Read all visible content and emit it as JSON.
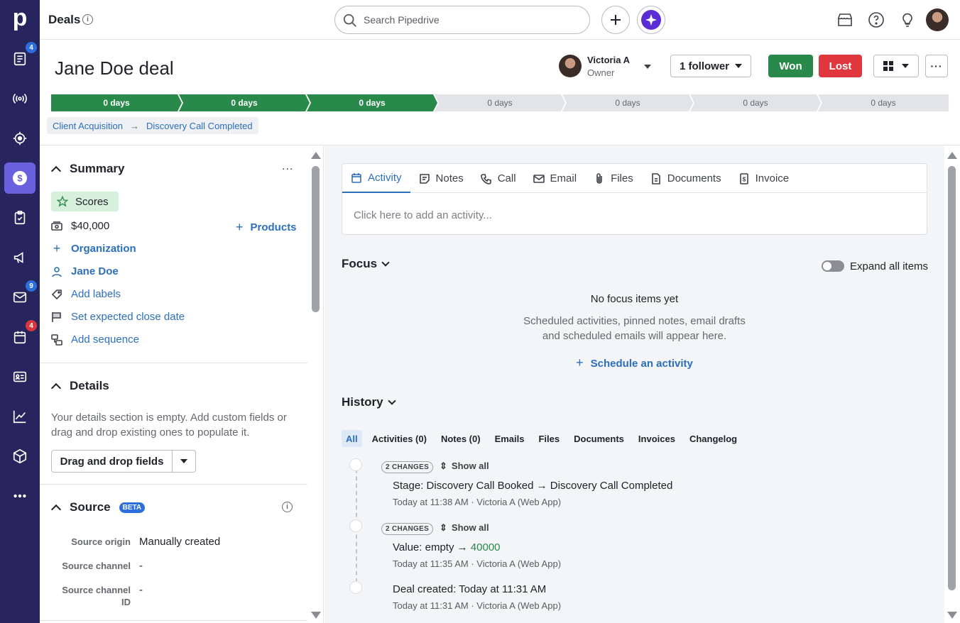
{
  "app": {
    "brand_letter": "p",
    "accent": "#6a61e0",
    "nav_bg": "#26255e"
  },
  "nav": {
    "items": [
      {
        "icon": "leads-icon",
        "badge": "4"
      },
      {
        "icon": "broadcast-icon"
      },
      {
        "icon": "target-icon"
      },
      {
        "icon": "deals-dollar-icon",
        "active": true
      },
      {
        "icon": "tasks-icon"
      },
      {
        "icon": "megaphone-icon"
      },
      {
        "icon": "mail-icon",
        "badge": "9"
      },
      {
        "icon": "calendar-icon",
        "badge": "4"
      },
      {
        "icon": "contacts-card-icon"
      },
      {
        "icon": "insights-chart-icon"
      },
      {
        "icon": "products-box-icon"
      },
      {
        "icon": "more-icon"
      }
    ]
  },
  "topbar": {
    "title": "Deals",
    "info": "i",
    "search_placeholder": "Search Pipedrive"
  },
  "deal": {
    "title": "Jane Doe deal",
    "owner_name": "Victoria A",
    "owner_role": "Owner",
    "followers": "1 follower",
    "won": "Won",
    "lost": "Lost",
    "stages": [
      {
        "label": "0 days",
        "done": true
      },
      {
        "label": "0 days",
        "done": true
      },
      {
        "label": "0 days",
        "done": true
      },
      {
        "label": "0 days",
        "done": false
      },
      {
        "label": "0 days",
        "done": false
      },
      {
        "label": "0 days",
        "done": false
      },
      {
        "label": "0 days",
        "done": false
      }
    ],
    "breadcrumb_pipeline": "Client Acquisition",
    "breadcrumb_arrow": "→",
    "breadcrumb_stage": "Discovery Call Completed"
  },
  "summary": {
    "title": "Summary",
    "more": "...",
    "scores": "Scores",
    "value": "$40,000",
    "products_plus": "+",
    "products": "Products",
    "org_plus": "+",
    "organization": "Organization",
    "person": "Jane Doe",
    "labels": "Add labels",
    "close_date": "Set expected close date",
    "sequence": "Add sequence"
  },
  "details": {
    "title": "Details",
    "empty_text_1": "Your details section is empty. Add custom fields or",
    "empty_text_2": "drag and drop existing ones to populate it.",
    "button": "Drag and drop fields"
  },
  "source": {
    "title": "Source",
    "badge": "BETA",
    "info": "i",
    "origin_label": "Source origin",
    "origin_value": "Manually created",
    "channel_label": "Source channel",
    "channel_value": "-",
    "channel_id_label_1": "Source channel",
    "channel_id_label_2": "ID",
    "channel_id_value": "-"
  },
  "tabs": [
    {
      "label": "Activity",
      "icon": "calendar-icon"
    },
    {
      "label": "Notes",
      "icon": "note-icon"
    },
    {
      "label": "Call",
      "icon": "phone-icon"
    },
    {
      "label": "Email",
      "icon": "mail-icon"
    },
    {
      "label": "Files",
      "icon": "paperclip-icon"
    },
    {
      "label": "Documents",
      "icon": "document-icon"
    },
    {
      "label": "Invoice",
      "icon": "invoice-icon"
    }
  ],
  "activity_placeholder": "Click here to add an activity...",
  "focus": {
    "title": "Focus",
    "expand": "Expand all items",
    "empty_title": "No focus items yet",
    "empty_line_1": "Scheduled activities, pinned notes, email drafts",
    "empty_line_2": "and scheduled emails will appear here.",
    "schedule_plus": "+",
    "schedule": "Schedule an activity"
  },
  "history": {
    "title": "History",
    "tabs": [
      "All",
      "Activities (0)",
      "Notes (0)",
      "Emails",
      "Files",
      "Documents",
      "Invoices",
      "Changelog"
    ],
    "show_all": "Show all",
    "entries": [
      {
        "changes": "2 CHANGES",
        "field": "Stage",
        "sep": ": ",
        "text": "Discovery Call Booked → Discovery Call Completed",
        "meta": "Today at 11:38 AM · Victoria A (Web App)"
      },
      {
        "changes": "2 CHANGES",
        "field": "Value",
        "sep": ": ",
        "text": "empty → ",
        "highlight": "40000",
        "meta": "Today at 11:35 AM · Victoria A (Web App)"
      },
      {
        "field": "Deal created",
        "sep": ": ",
        "text": "Today at 11:31 AM",
        "meta": "Today at 11:31 AM · Victoria A (Web App)"
      }
    ]
  }
}
